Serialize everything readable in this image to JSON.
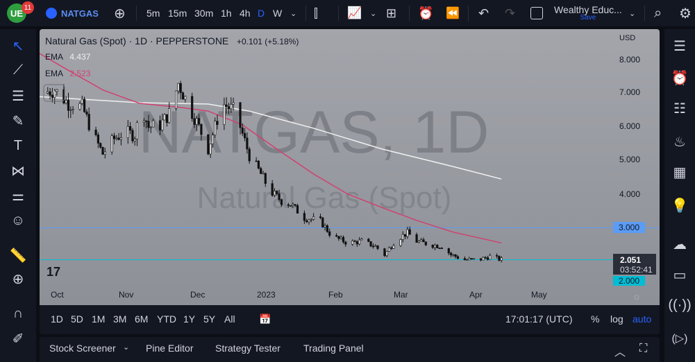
{
  "topbar": {
    "notif_count": "11",
    "symbol": "NATGAS",
    "intervals": [
      "5m",
      "15m",
      "30m",
      "1h",
      "4h",
      "D",
      "W"
    ],
    "active_interval": "D",
    "layout_name": "Wealthy Educ...",
    "save_label": "Save"
  },
  "legend": {
    "title": "Natural Gas (Spot) · 1D · PEPPERSTONE",
    "change": "+0.101 (+5.18%)",
    "ema1_label": "EMA",
    "ema1_value": "4.437",
    "ema2_label": "EMA",
    "ema2_value": "2.523"
  },
  "watermark": {
    "line1": "NATGAS, 1D",
    "line2": "Natural Gas (Spot)"
  },
  "price_axis": {
    "currency": "USD",
    "ticks": [
      "8.000",
      "7.000",
      "6.000",
      "5.000",
      "4.000"
    ],
    "line_label": "3.000",
    "last_price": "2.051",
    "countdown": "03:52:41",
    "line2_label": "2.000"
  },
  "time_axis": [
    "Oct",
    "Nov",
    "Dec",
    "2023",
    "Feb",
    "Mar",
    "Apr",
    "May"
  ],
  "ranges": [
    "1D",
    "5D",
    "1M",
    "3M",
    "6M",
    "YTD",
    "1Y",
    "5Y",
    "All"
  ],
  "clock": "17:01:17 (UTC)",
  "scale_opts": {
    "percent": "%",
    "log": "log",
    "auto": "auto"
  },
  "bottom_tabs": [
    "Stock Screener",
    "Pine Editor",
    "Strategy Tester",
    "Trading Panel"
  ],
  "colors": {
    "ema_fast": "#d0416f",
    "ema_slow": "#f0f0f0",
    "hline": "#5b9cf6",
    "hline2": "#00bcd4",
    "accent": "#2962ff"
  },
  "chart_data": {
    "type": "candlestick",
    "ylim": [
      1.3,
      9.2
    ],
    "x_unit": "days since 2022-10-01",
    "close_points": [
      [
        -7,
        7.0
      ],
      [
        -1,
        7.1
      ],
      [
        5,
        6.7
      ],
      [
        11,
        6.6
      ],
      [
        16,
        5.75
      ],
      [
        20,
        5.2
      ],
      [
        25,
        5.65
      ],
      [
        30,
        5.85
      ],
      [
        34,
        5.75
      ],
      [
        37,
        6.6
      ],
      [
        40,
        6.0
      ],
      [
        45,
        6.05
      ],
      [
        49,
        6.4
      ],
      [
        53,
        7.3
      ],
      [
        57,
        6.7
      ],
      [
        61,
        6.15
      ],
      [
        66,
        5.35
      ],
      [
        69,
        6.0
      ],
      [
        72,
        6.7
      ],
      [
        77,
        6.5
      ],
      [
        80,
        6.0
      ],
      [
        84,
        5.15
      ],
      [
        89,
        4.6
      ],
      [
        93,
        4.1
      ],
      [
        98,
        3.8
      ],
      [
        102,
        3.7
      ],
      [
        108,
        3.3
      ],
      [
        115,
        3.2
      ],
      [
        120,
        2.75
      ],
      [
        127,
        2.55
      ],
      [
        133,
        2.6
      ],
      [
        139,
        2.45
      ],
      [
        143,
        2.2
      ],
      [
        148,
        2.65
      ],
      [
        153,
        2.85
      ],
      [
        157,
        2.6
      ],
      [
        163,
        2.5
      ],
      [
        168,
        2.45
      ],
      [
        172,
        2.2
      ],
      [
        178,
        2.05
      ],
      [
        184,
        2.05
      ],
      [
        189,
        2.15
      ],
      [
        194,
        2.05
      ]
    ],
    "ema_slow": [
      [
        -8,
        6.9
      ],
      [
        36,
        6.72
      ],
      [
        66,
        6.68
      ],
      [
        84,
        6.47
      ],
      [
        112,
        5.96
      ],
      [
        142,
        5.34
      ],
      [
        173,
        4.82
      ],
      [
        194,
        4.45
      ]
    ],
    "ema_fast": [
      [
        -8,
        8.2
      ],
      [
        2,
        7.8
      ],
      [
        20,
        7.1
      ],
      [
        36,
        6.7
      ],
      [
        54,
        6.58
      ],
      [
        66,
        6.47
      ],
      [
        81,
        6.06
      ],
      [
        96,
        5.34
      ],
      [
        112,
        4.6
      ],
      [
        127,
        4.0
      ],
      [
        142,
        3.6
      ],
      [
        157,
        3.22
      ],
      [
        173,
        2.87
      ],
      [
        194,
        2.55
      ]
    ],
    "hlines": [
      3.0,
      2.051
    ]
  }
}
